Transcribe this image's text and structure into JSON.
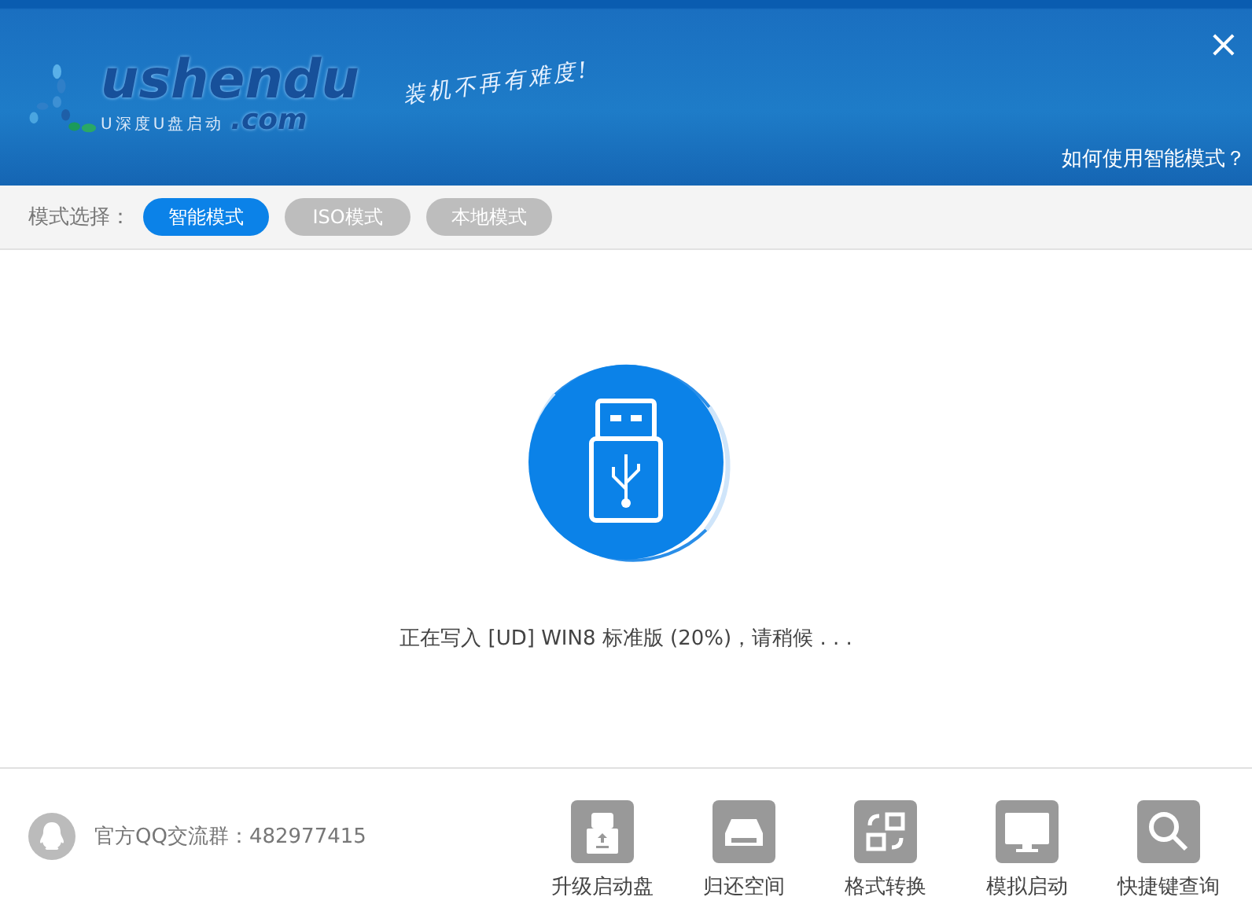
{
  "header": {
    "logo": {
      "wordmark": "ushendu",
      "domain": ".com",
      "tagline": "U深度U盘启动"
    },
    "slogan": "装机不再有难度!",
    "close": "×",
    "help_link": "如何使用智能模式？"
  },
  "mode_bar": {
    "label": "模式选择：",
    "modes": [
      {
        "label": "智能模式",
        "selected": true
      },
      {
        "label": "ISO模式",
        "selected": false
      },
      {
        "label": "本地模式",
        "selected": false
      }
    ]
  },
  "progress": {
    "status": "正在写入 [UD] WIN8 标准版 (20%)，请稍候 . . ."
  },
  "footer": {
    "qq_group": "官方QQ交流群：482977415",
    "tools": [
      {
        "label": "升级启动盘"
      },
      {
        "label": "归还空间"
      },
      {
        "label": "格式转换"
      },
      {
        "label": "模拟启动"
      },
      {
        "label": "快捷键查询"
      }
    ]
  }
}
